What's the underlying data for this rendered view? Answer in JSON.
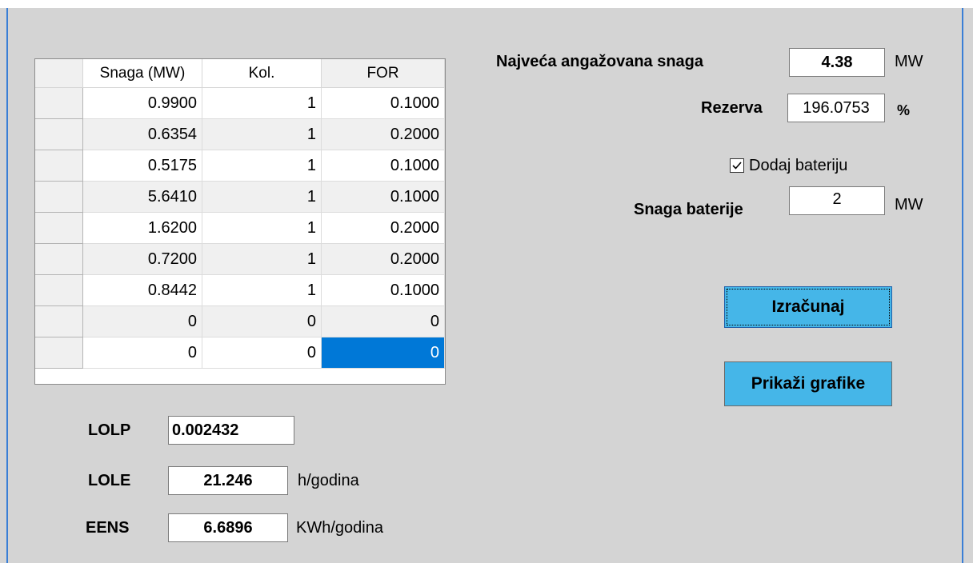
{
  "grid": {
    "columns": [
      "Snaga (MW)",
      "Kol.",
      "FOR"
    ],
    "rows": [
      {
        "snaga": "0.9900",
        "kol": "1",
        "for": "0.1000"
      },
      {
        "snaga": "0.6354",
        "kol": "1",
        "for": "0.2000"
      },
      {
        "snaga": "0.5175",
        "kol": "1",
        "for": "0.1000"
      },
      {
        "snaga": "5.6410",
        "kol": "1",
        "for": "0.1000"
      },
      {
        "snaga": "1.6200",
        "kol": "1",
        "for": "0.2000"
      },
      {
        "snaga": "0.7200",
        "kol": "1",
        "for": "0.2000"
      },
      {
        "snaga": "0.8442",
        "kol": "1",
        "for": "0.1000"
      },
      {
        "snaga": "0",
        "kol": "0",
        "for": "0"
      },
      {
        "snaga": "0",
        "kol": "0",
        "for": "0"
      }
    ],
    "selected_color": "#0078d7"
  },
  "results": {
    "lolp": {
      "label": "LOLP",
      "value": "0.002432"
    },
    "lole": {
      "label": "LOLE",
      "value": "21.246",
      "unit": "h/godina"
    },
    "eens": {
      "label": "EENS",
      "value": "6.6896",
      "unit": "KWh/godina"
    }
  },
  "params": {
    "peak": {
      "label": "Najveća angažovana snaga",
      "value": "4.38",
      "unit": "MW"
    },
    "reserve": {
      "label": "Rezerva",
      "value": "196.0753",
      "unit": "%"
    },
    "battery_checkbox": {
      "label": "Dodaj bateriju",
      "checked": true
    },
    "battery_power": {
      "label": "Snaga baterije",
      "value": "2",
      "unit": "MW"
    }
  },
  "buttons": {
    "calculate": "Izračunaj",
    "show_charts": "Prikaži grafike",
    "accent": "#45b6e8"
  }
}
